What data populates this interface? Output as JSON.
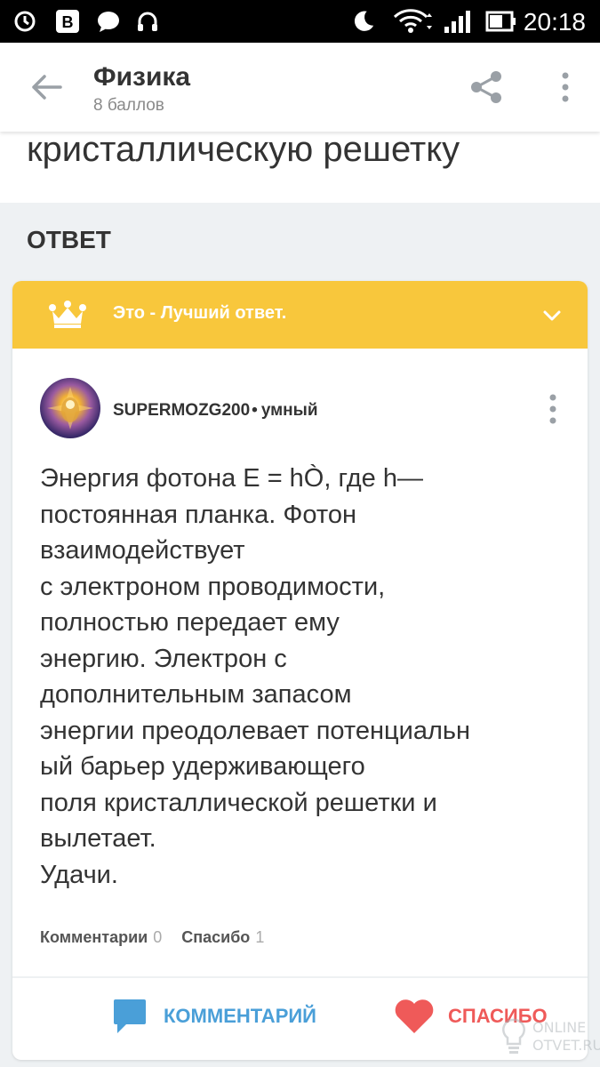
{
  "status_bar": {
    "time": "20:18",
    "icons": [
      "sync-icon",
      "vk-icon",
      "chat-bubble-icon",
      "headphones-icon",
      "moon-icon",
      "wifi-icon",
      "signal-icon",
      "battery-icon"
    ]
  },
  "app_bar": {
    "title": "Физика",
    "subtitle": "8 баллов",
    "back_icon": "arrow-left-icon",
    "share_icon": "share-icon",
    "menu_icon": "more-vertical-icon"
  },
  "question": {
    "visible_tail": "кристаллическую решетку"
  },
  "answer_section": {
    "heading": "ОТВЕТ",
    "best_banner": {
      "label": "Это - Лучший ответ.",
      "icon": "crown-icon",
      "accent": "#f8c73c"
    },
    "author": {
      "name": "SUPERMOZG200",
      "separator": "•",
      "rank": "умный"
    },
    "text_lines": [
      "Энергия фотона E = hÒ, где h—",
      "постоянная планка. Фотон",
      "взаимодействует",
      "с электроном проводимости,",
      "полностью передает ему",
      "энергию. Электрон с",
      "дополнительным запасом",
      "энергии преодолевает потенциальн",
      "ый барьер удерживающего",
      "поля кристаллической решетки и",
      "вылетает.",
      "Удачи."
    ],
    "stats": {
      "comments_label": "Комментарии",
      "comments_count": "0",
      "thanks_label": "Спасибо",
      "thanks_count": "1"
    },
    "actions": {
      "comment_label": "КОММЕНТАРИЙ",
      "thanks_label": "СПАСИБО",
      "comment_color": "#4a9fd8",
      "thanks_color": "#ef5a59"
    }
  },
  "watermark": {
    "line1": "ONLINE",
    "line2": "OTVET.RU"
  }
}
